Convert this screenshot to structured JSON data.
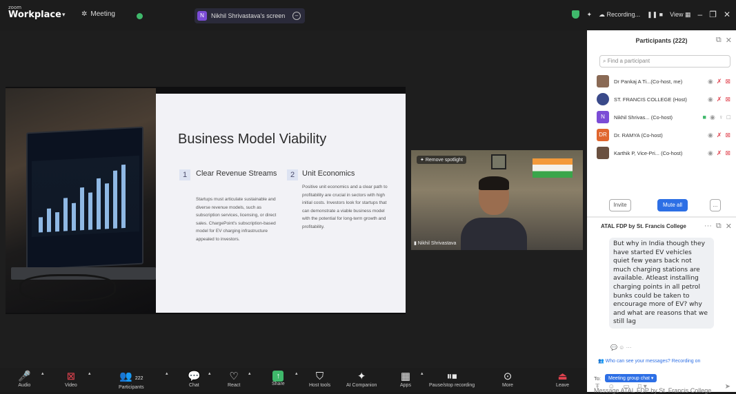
{
  "topbar": {
    "logo_small": "zoom",
    "logo_big": "Workplace",
    "meeting_label": "Meeting",
    "share_label": "Nikhil Shrivastava's screen",
    "share_initial": "N",
    "recording_label": "Recording...",
    "view_label": "View"
  },
  "slide": {
    "title": "Business Model Viability",
    "col1_num": "1",
    "col1_head": "Clear Revenue Streams",
    "col1_text": "Startups must articulate sustainable and diverse revenue models, such as subscription services, licensing, or direct sales. ChargePoint's subscription-based model for EV charging infrastructure appealed to investors.",
    "col2_num": "2",
    "col2_head": "Unit Economics",
    "col2_text": "Positive unit economics and a clear path to profitability are crucial in sectors with high initial costs. Investors look for startups that can demonstrate a viable business model with the potential for long-term growth and profitability."
  },
  "video": {
    "spotlight": "Remove spotlight",
    "name": "Nikhil Shrivastava"
  },
  "toolbar": {
    "audio": "Audio",
    "video": "Video",
    "participants": "Participants",
    "participants_count": "222",
    "chat": "Chat",
    "react": "React",
    "share": "Share",
    "host_tools": "Host tools",
    "ai_companion": "AI Companion",
    "apps": "Apps",
    "pause_recording": "Pause/stop recording",
    "more": "More",
    "leave": "Leave"
  },
  "panel": {
    "title": "Participants (222)",
    "search_placeholder": "Find a participant",
    "participants": [
      {
        "name": "Dr Pankaj A Ti...(Co-host, me)",
        "initial": "",
        "color": "#8a6a55"
      },
      {
        "name": "ST. FRANCIS COLLEGE (Host)",
        "initial": "",
        "color": "#3a4a8a"
      },
      {
        "name": "Nikhil Shrivas... (Co-host)",
        "initial": "N",
        "color": "#7b4cd6"
      },
      {
        "name": "Dr. RAMYA (Co-host)",
        "initial": "DR",
        "color": "#e0662e"
      },
      {
        "name": "Karthik P, Vice-Pri... (Co-host)",
        "initial": "",
        "color": "#6a5040"
      }
    ],
    "invite": "Invite",
    "mute_all": "Mute all",
    "more": "...",
    "chat_title": "ATAL FDP by St. Francis College",
    "chat_message": "But why in India though they have started EV vehicles quiet few years back not much charging stations are available. Atleast installing charging points in all petrol bunks could be taken to encourage more of EV? why and what are reasons that we still lag",
    "who_can_see": "Who can see your messages? Recording on",
    "to_label": "To:",
    "to_value": "Meeting group chat",
    "message_placeholder": "Message ATAL FDP by St. Francis College"
  }
}
